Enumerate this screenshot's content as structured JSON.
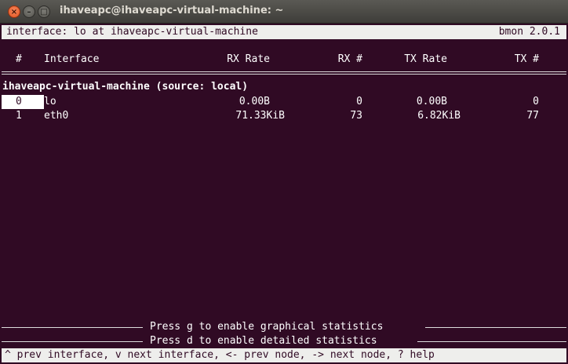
{
  "window": {
    "title": "ihaveapc@ihaveapc-virtual-machine: ~",
    "close_glyph": "×",
    "minimize_glyph": "–",
    "maximize_glyph": "□"
  },
  "status": {
    "left": "interface: lo at ihaveapc-virtual-machine",
    "right": "bmon 2.0.1"
  },
  "table": {
    "headers": {
      "num": "#",
      "interface": "Interface",
      "rx_rate": "RX Rate",
      "rx_num": "RX #",
      "tx_rate": "TX Rate",
      "tx_num": "TX #"
    },
    "node_title": "ihaveapc-virtual-machine (source: local)",
    "rows": [
      {
        "num": "0",
        "interface": "lo",
        "rx_rate": "0.00B",
        "rx_num": "0",
        "tx_rate": "0.00B",
        "tx_num": "0",
        "selected": true
      },
      {
        "num": "1",
        "interface": "eth0",
        "rx_rate": "71.33KiB",
        "rx_num": "73",
        "tx_rate": "6.82KiB",
        "tx_num": "77",
        "selected": false
      }
    ]
  },
  "hints": {
    "graphical": "Press g to enable graphical statistics",
    "detailed": "Press d to enable detailed statistics",
    "keys": "^ prev interface, v next interface, <- prev node, -> next node, ? help"
  }
}
